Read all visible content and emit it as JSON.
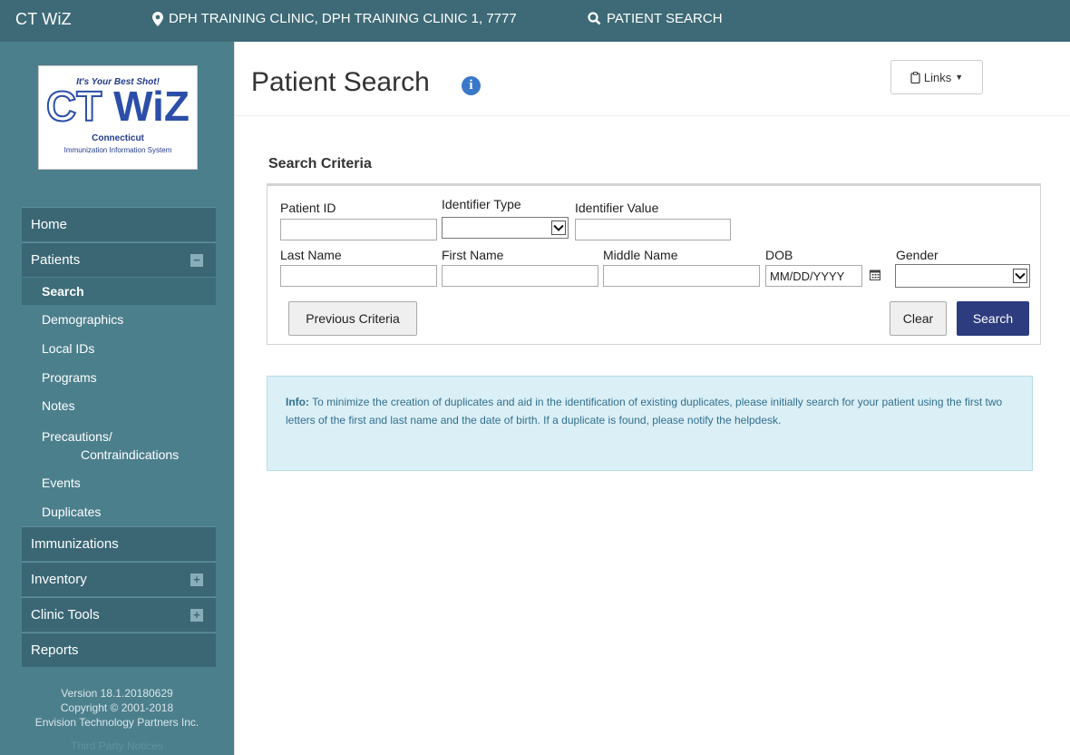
{
  "topbar": {
    "brand": "CT WiZ",
    "location": "DPH TRAINING CLINIC, DPH TRAINING CLINIC 1, 7777",
    "patient_search": "PATIENT SEARCH"
  },
  "logo": {
    "tagline": "It's Your Best Shot!",
    "ct": "CT",
    "wiz": "WiZ",
    "state": "Connecticut",
    "system": "Immunization Information System"
  },
  "sidebar": {
    "home": "Home",
    "patients": "Patients",
    "patients_toggle": "−",
    "patient_items": [
      "Search",
      "Demographics",
      "Local IDs",
      "Programs",
      "Notes",
      "Precautions/",
      "Contraindications",
      "Events",
      "Duplicates"
    ],
    "immunizations": "Immunizations",
    "inventory": "Inventory",
    "inventory_toggle": "+",
    "clinic_tools": "Clinic Tools",
    "clinic_tools_toggle": "+",
    "reports": "Reports",
    "version": "Version 18.1.20180629",
    "copyright": "Copyright © 2001-2018",
    "company": "Envision Technology Partners Inc.",
    "third_party": "Third Party Notices"
  },
  "header": {
    "title": "Patient Search",
    "info_icon": "i",
    "links_label": "Links"
  },
  "search_criteria": {
    "title": "Search Criteria",
    "labels": {
      "patient_id": "Patient ID",
      "identifier_type": "Identifier Type",
      "identifier_value": "Identifier Value",
      "last_name": "Last Name",
      "first_name": "First Name",
      "middle_name": "Middle Name",
      "dob": "DOB",
      "gender": "Gender"
    },
    "values": {
      "patient_id": "",
      "identifier_type": "",
      "identifier_value": "",
      "last_name": "",
      "first_name": "",
      "middle_name": "",
      "dob": "MM/DD/YYYY",
      "gender": ""
    },
    "buttons": {
      "previous": "Previous Criteria",
      "clear": "Clear",
      "search": "Search"
    }
  },
  "info": {
    "label": "Info:",
    "text": "To minimize the creation of duplicates and aid in the identification of existing duplicates, please initially search for your patient using the first two letters of the first and last name and the date of birth. If a duplicate is found, please notify the helpdesk."
  },
  "colors": {
    "topbar": "#3d6a76",
    "sidebar": "#4c7f8c",
    "primary_button": "#2d3b7f",
    "info_bg": "#dbeff6"
  }
}
